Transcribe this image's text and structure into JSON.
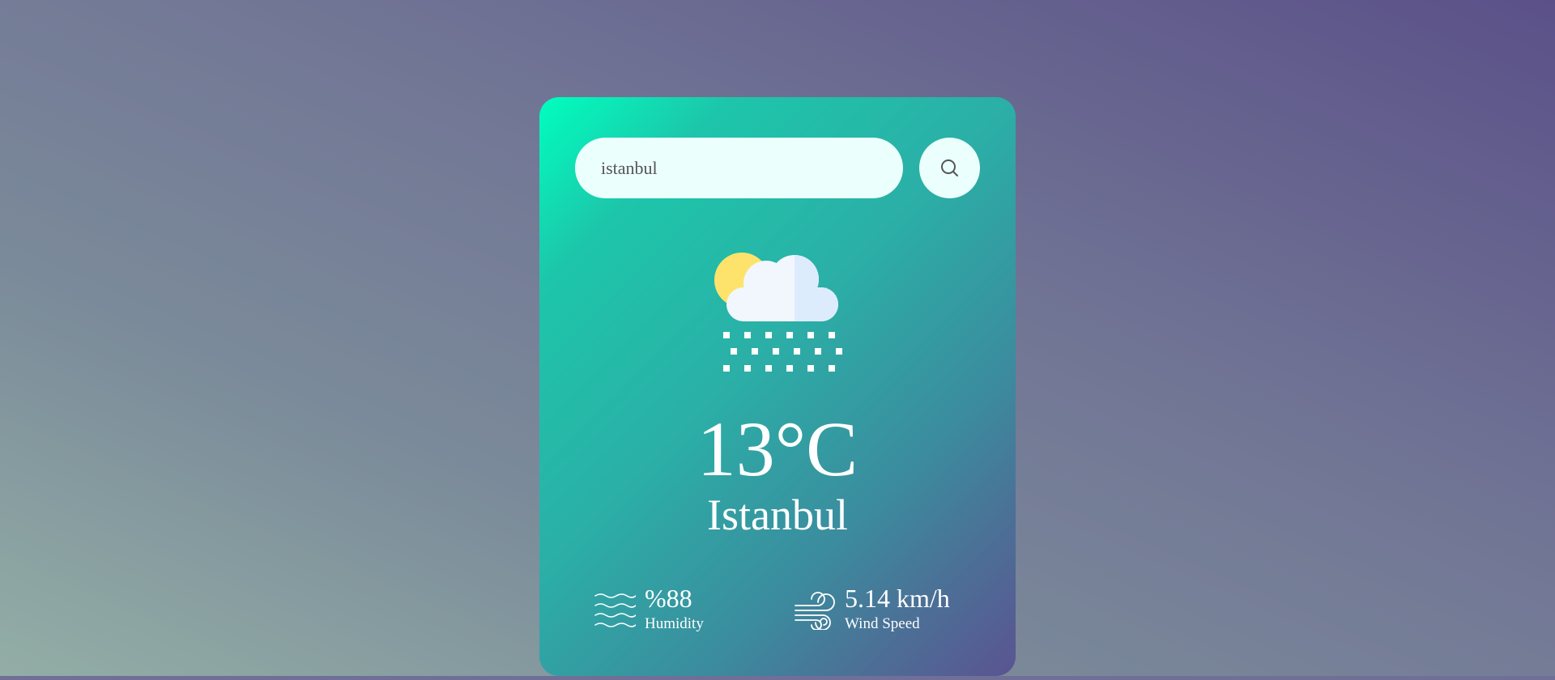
{
  "search": {
    "value": "istanbul",
    "icon": "search-icon"
  },
  "weather": {
    "icon": "partly-cloudy-snow-icon",
    "temperature": "13°C",
    "city": "Istanbul"
  },
  "details": {
    "humidity": {
      "icon": "humidity-waves-icon",
      "value": "%88",
      "label": "Humidity"
    },
    "wind": {
      "icon": "wind-icon",
      "value": "5.14 km/h",
      "label": "Wind Speed"
    }
  },
  "colors": {
    "card_gradient_start": "#00ffbf",
    "card_gradient_end": "#5a5491",
    "input_background": "#ebfffc",
    "text": "#ffffff"
  }
}
